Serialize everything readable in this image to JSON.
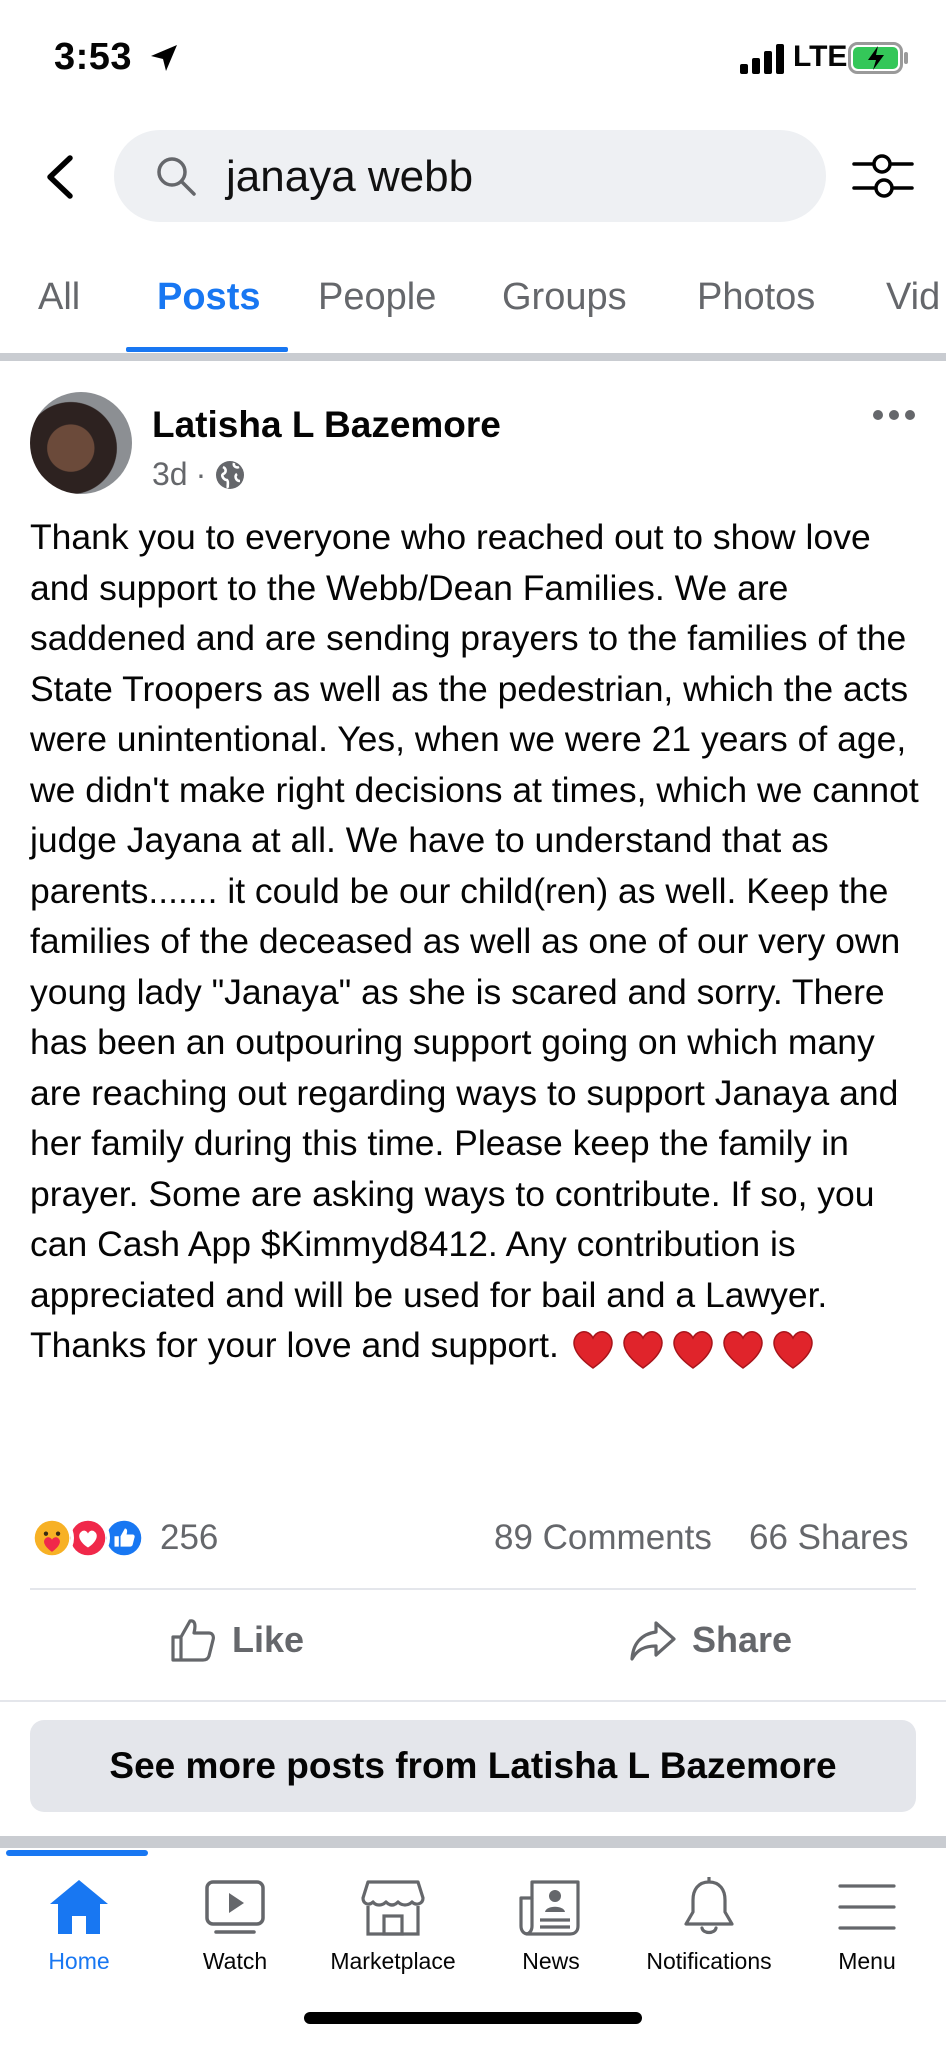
{
  "status_bar": {
    "time": "3:53",
    "network": "LTE"
  },
  "search": {
    "query": "janaya webb"
  },
  "tabs": [
    {
      "label": "All"
    },
    {
      "label": "Posts"
    },
    {
      "label": "People"
    },
    {
      "label": "Groups"
    },
    {
      "label": "Photos"
    },
    {
      "label": "Vid"
    }
  ],
  "active_tab": "Posts",
  "post": {
    "author": "Latisha L Bazemore",
    "age": "3d",
    "separator": "·",
    "body": "Thank you to everyone who reached out to show love and support to the Webb/Dean Families. We are saddened and are sending prayers to the families of the State Troopers as well as the pedestrian, which the acts were unintentional. Yes, when we were 21 years of age, we didn't make right decisions at times, which we cannot judge Jayana at all. We have to understand that as parents....... it could be our child(ren) as well. Keep the families of the deceased as well as one of our very own young lady \"Janaya\" as she is scared and sorry. There has been an outpouring support going on which many are reaching out regarding ways to support Janaya and her family during this time. Please keep the family in prayer. Some are asking ways to contribute. If so, you can Cash App $Kimmyd8412. Any contribution is appreciated and will be used for bail and a Lawyer. Thanks for your love and support.",
    "reaction_count": "256",
    "comments": "89 Comments",
    "shares": "66 Shares",
    "like_label": "Like",
    "share_label": "Share",
    "see_more_label": "See more posts from Latisha L Bazemore"
  },
  "nav": [
    {
      "label": "Home",
      "icon": "home-icon"
    },
    {
      "label": "Watch",
      "icon": "watch-icon"
    },
    {
      "label": "Marketplace",
      "icon": "marketplace-icon"
    },
    {
      "label": "News",
      "icon": "news-icon"
    },
    {
      "label": "Notifications",
      "icon": "bell-icon"
    },
    {
      "label": "Menu",
      "icon": "menu-icon"
    }
  ],
  "colors": {
    "accent": "#1877f2",
    "secondary_text": "#65676b",
    "divider": "#c9ccd1"
  }
}
